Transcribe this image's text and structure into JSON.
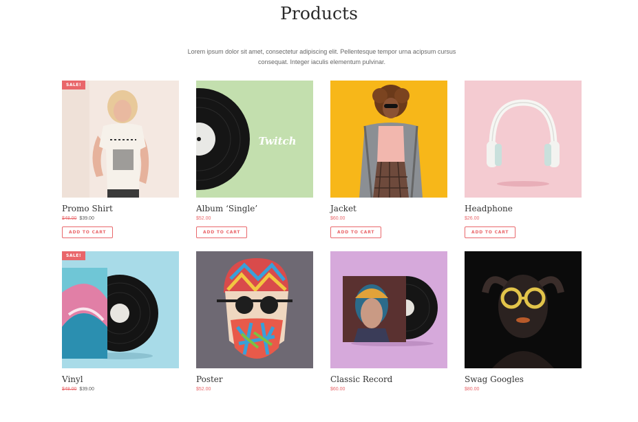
{
  "header": {
    "title": "Products",
    "description": "Lorem ipsum dolor sit amet, consectetur adipiscing elit. Pellentesque tempor urna acipsum cursus consequat. Integer iaculis elementum pulvinar."
  },
  "colors": {
    "accent": "#e9666a"
  },
  "products": [
    {
      "name": "Promo Shirt",
      "sale_badge": "SALE!",
      "old_price": "$48.00",
      "price": "$39.00",
      "button": "ADD TO CART",
      "image": "woman-in-star-tshirt"
    },
    {
      "name": "Album ‘Single’",
      "old_price": "",
      "price": "$52.00",
      "button": "ADD TO CART",
      "image": "vinyl-record-on-green"
    },
    {
      "name": "Jacket",
      "old_price": "",
      "price": "$60.00",
      "button": "ADD TO CART",
      "image": "woman-in-plaid-coat-on-yellow"
    },
    {
      "name": "Headphone",
      "old_price": "",
      "price": "$26.00",
      "button": "ADD TO CART",
      "image": "white-headphones-on-pink"
    },
    {
      "name": "Vinyl",
      "sale_badge": "SALE!",
      "old_price": "$48.00",
      "price": "$39.00",
      "button": "",
      "image": "wave-vinyl-on-blue"
    },
    {
      "name": "Poster",
      "old_price": "",
      "price": "$52.00",
      "button": "",
      "image": "colorful-bearded-man-illustration"
    },
    {
      "name": "Classic Record",
      "old_price": "",
      "price": "$60.00",
      "button": "",
      "image": "portrait-record-on-purple"
    },
    {
      "name": "Swag Googles",
      "old_price": "",
      "price": "$80.00",
      "button": "",
      "image": "woman-yellow-glasses-on-black"
    }
  ]
}
